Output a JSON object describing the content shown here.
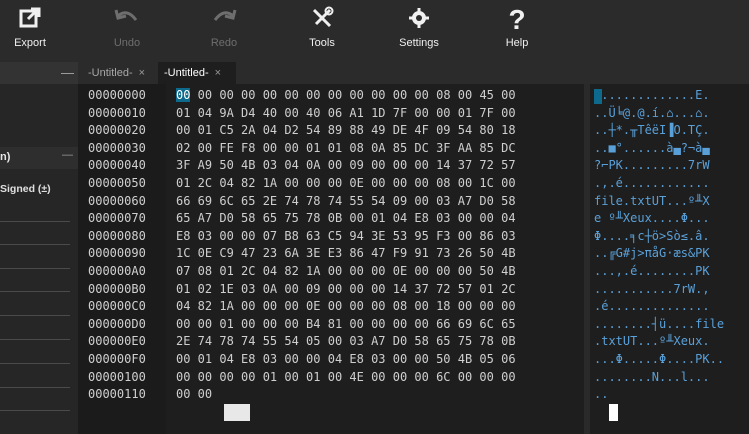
{
  "toolbar": {
    "export": "Export",
    "undo": "Undo",
    "redo": "Redo",
    "tools": "Tools",
    "settings": "Settings",
    "help": "Help"
  },
  "tabs": [
    {
      "label": "-Untitled-",
      "close": "×",
      "active": false
    },
    {
      "label": "-Untitled-",
      "close": "×",
      "active": true
    }
  ],
  "left_panel": {
    "tab_stub_minus": "—",
    "section_title": "n)",
    "section_minus": "—",
    "signed_label": "Signed (±)"
  },
  "hex": {
    "addresses": [
      "00000000",
      "00000010",
      "00000020",
      "00000030",
      "00000040",
      "00000050",
      "00000060",
      "00000070",
      "00000080",
      "00000090",
      "000000A0",
      "000000B0",
      "000000C0",
      "000000D0",
      "000000E0",
      "000000F0",
      "00000100",
      "00000110"
    ],
    "rows": [
      "00 00 00 00 00 00 00 00 00 00 00 00 08 00 45 00",
      "01 04 9A D4 40 00 40 06 A1 1D 7F 00 00 01 7F 00",
      "00 01 C5 2A 04 D2 54 89 88 49 DE 4F 09 54 80 18",
      "02 00 FE F8 00 00 01 01 08 0A 85 DC 3F AA 85 DC",
      "3F A9 50 4B 03 04 0A 00 09 00 00 00 14 37 72 57",
      "01 2C 04 82 1A 00 00 00 0E 00 00 00 08 00 1C 00",
      "66 69 6C 65 2E 74 78 74 55 54 09 00 03 A7 D0 58",
      "65 A7 D0 58 65 75 78 0B 00 01 04 E8 03 00 00 04",
      "E8 03 00 00 07 B8 63 C5 94 3E 53 95 F3 00 86 03",
      "1C 0E C9 47 23 6A 3E E3 86 47 F9 91 73 26 50 4B",
      "07 08 01 2C 04 82 1A 00 00 00 0E 00 00 00 50 4B",
      "01 02 1E 03 0A 00 09 00 00 00 14 37 72 57 01 2C",
      "04 82 1A 00 00 00 0E 00 00 00 08 00 18 00 00 00",
      "00 00 01 00 00 00 B4 81 00 00 00 00 66 69 6C 65",
      "2E 74 78 74 55 54 05 00 03 A7 D0 58 65 75 78 0B",
      "00 01 04 E8 03 00 00 04 E8 03 00 00 50 4B 05 06",
      "00 00 00 00 01 00 01 00 4E 00 00 00 6C 00 00 00",
      "00 00"
    ],
    "ascii": [
      "..............E.",
      "..Ü╘@.@.í.⌂...⌂.",
      "..┼*.╥TêëI▐O.TÇ.",
      "..■°......à▄?¬à▄",
      "?⌐PK.........7rW",
      ".,.é............",
      "file.txtUT...º╨X",
      "e º╨Xeux....Φ...",
      "Φ....╕c┼ö>Sò≤.â.",
      "..╔G#j>πåG·æs&PK",
      "...,.é........PK",
      "...........7rW.,",
      ".é..............",
      "........┤ü....file",
      ".txtUT...º╨Xeux.",
      "...Φ.....Φ....PK..",
      "........N...l...",
      ".."
    ]
  }
}
